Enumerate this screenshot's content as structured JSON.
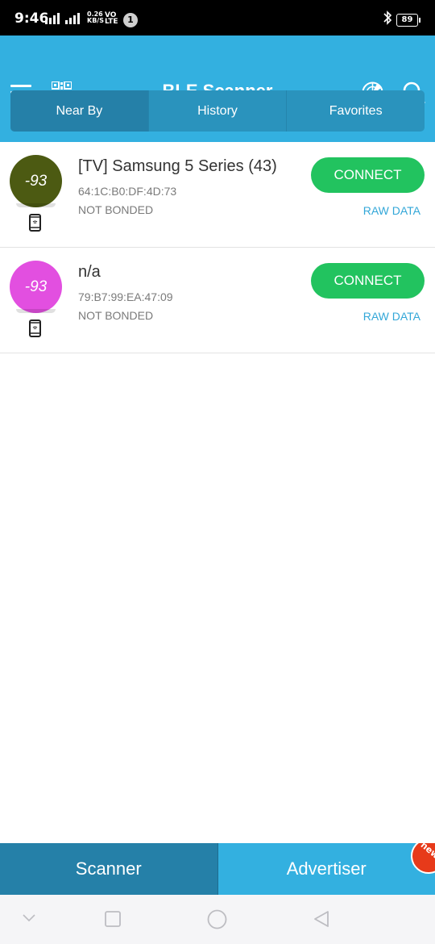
{
  "status_bar": {
    "time": "9:46",
    "net_speed_top": "0.26",
    "net_speed_bottom": "KB/S",
    "vo_top": "VO",
    "vo_bottom": "LTE",
    "notification_count": "1",
    "battery": "89"
  },
  "appbar": {
    "title": "BLE Scanner",
    "color": "#33b0e0"
  },
  "tabs": [
    {
      "label": "Near By",
      "active": true
    },
    {
      "label": "History",
      "active": false
    },
    {
      "label": "Favorites",
      "active": false
    }
  ],
  "devices": [
    {
      "rssi": "-93",
      "rssi_color": "#4c5a12",
      "name": "[TV] Samsung 5 Series (43)",
      "mac": "64:1C:B0:DF:4D:73",
      "bond": "NOT BONDED",
      "connect_label": "CONNECT",
      "raw_label": "RAW DATA"
    },
    {
      "rssi": "-93",
      "rssi_color": "#e24fe0",
      "name": "n/a",
      "mac": "79:B7:99:EA:47:09",
      "bond": "NOT BONDED",
      "connect_label": "CONNECT",
      "raw_label": "RAW DATA"
    }
  ],
  "bottom_tabs": {
    "scanner": "Scanner",
    "advertiser": "Advertiser",
    "new_badge": "new"
  },
  "colors": {
    "connect": "#22c35f",
    "raw_link": "#33a7d8",
    "tab_active": "#2580a8"
  }
}
